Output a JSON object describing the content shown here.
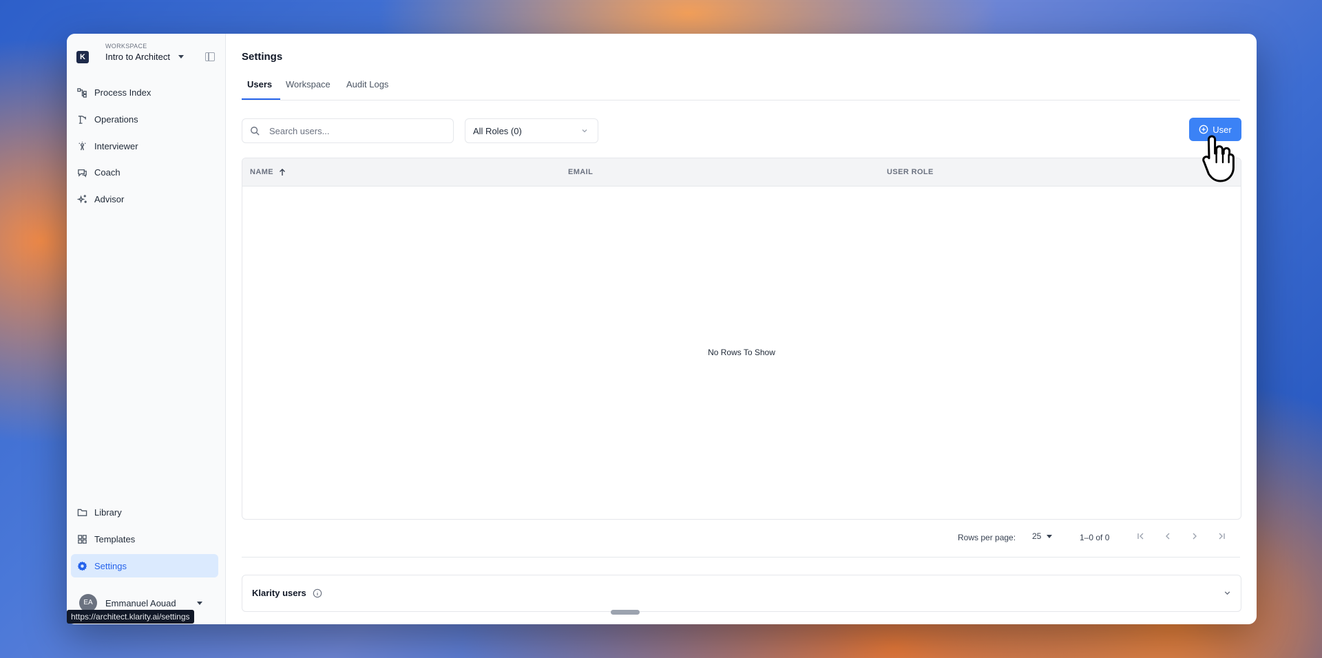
{
  "workspace": {
    "caption": "WORKSPACE",
    "name": "Intro to Architect",
    "logo_letter": "K"
  },
  "sidebar": {
    "top_items": [
      {
        "label": "Process Index",
        "icon": "process-index-icon"
      },
      {
        "label": "Operations",
        "icon": "operations-icon"
      },
      {
        "label": "Interviewer",
        "icon": "interviewer-icon"
      },
      {
        "label": "Coach",
        "icon": "coach-icon"
      },
      {
        "label": "Advisor",
        "icon": "advisor-icon"
      }
    ],
    "bottom_items": [
      {
        "label": "Library",
        "icon": "folder-icon"
      },
      {
        "label": "Templates",
        "icon": "templates-icon"
      },
      {
        "label": "Settings",
        "icon": "gear-icon",
        "active": true
      }
    ],
    "user": {
      "initials": "EA",
      "name": "Emmanuel Aouad"
    }
  },
  "page": {
    "title": "Settings",
    "tabs": [
      {
        "label": "Users",
        "active": true
      },
      {
        "label": "Workspace"
      },
      {
        "label": "Audit Logs"
      }
    ]
  },
  "toolbar": {
    "search_placeholder": "Search users...",
    "roles_filter": "All Roles (0)",
    "add_user_label": "User"
  },
  "table": {
    "columns": [
      "NAME",
      "EMAIL",
      "USER ROLE"
    ],
    "empty_message": "No Rows To Show"
  },
  "pagination": {
    "rows_per_page_label": "Rows per page:",
    "rows_per_page": "25",
    "range": "1–0 of 0"
  },
  "klarity_panel": {
    "title": "Klarity users"
  },
  "status_url": "https://architect.klarity.ai/settings",
  "colors": {
    "accent": "#3b82f6",
    "active_bg": "#dbeafe",
    "logo_bg": "#1e2a4a"
  }
}
